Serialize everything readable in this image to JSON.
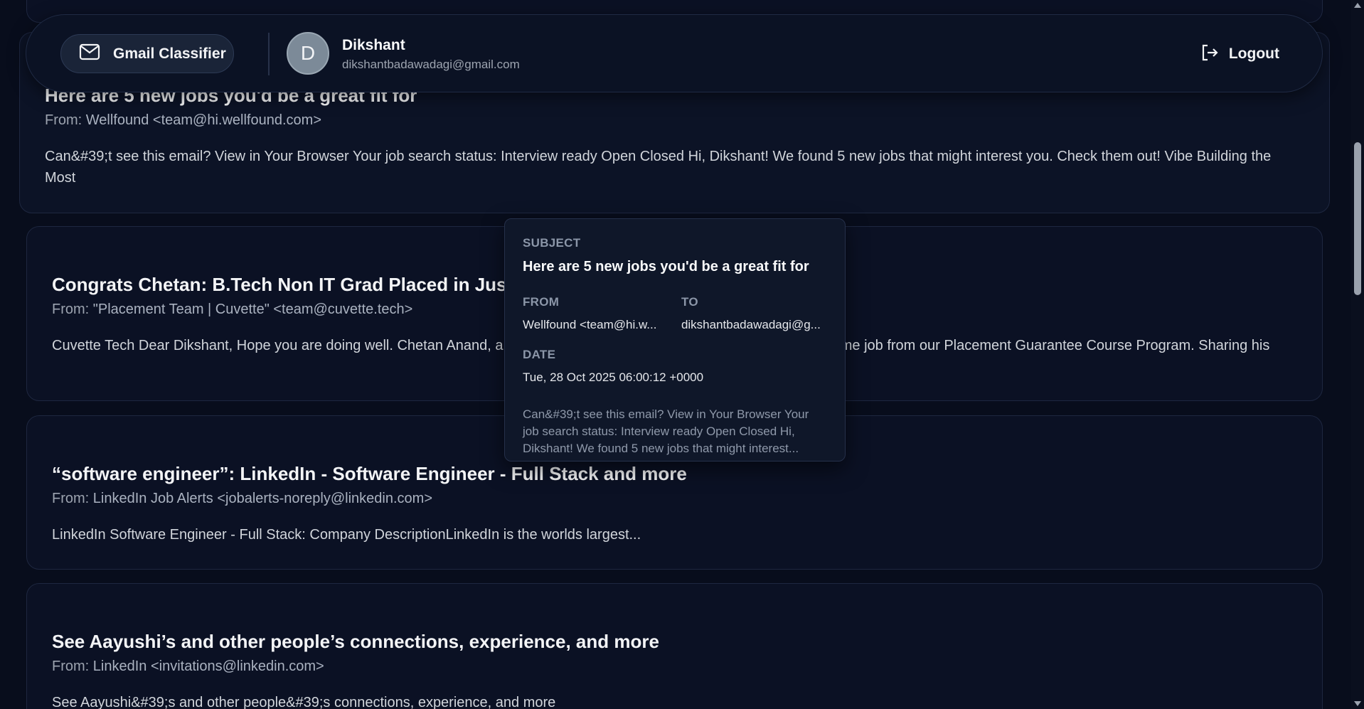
{
  "header": {
    "brand_label": "Gmail Classifier",
    "user": {
      "avatar_letter": "D",
      "name": "Dikshant",
      "email": "dikshantbadawadagi@gmail.com"
    },
    "logout_label": "Logout"
  },
  "from_prefix": "From:",
  "emails": [
    {
      "subject": "Here are 5 new jobs you'd be a great fit for",
      "sender": "Wellfound <team@hi.wellfound.com>",
      "snippet": "Can&#39;t see this email? View in Your Browser Your job search status: Interview ready Open Closed Hi, Dikshant! We found 5 new jobs that might interest you. Check them out! Vibe Building the Most"
    },
    {
      "subject": "Congrats Chetan: B.Tech Non IT Grad Placed in Just 2",
      "sender": "\"Placement Team | Cuvette\" <team@cuvette.tech>",
      "snippet": "Cuvette Tech Dear Dikshant, Hope you are doing well. Chetan Anand, a B.Tech Non IT Grad has successfully secured a full-time job from our Placement Guarantee Course Program. Sharing his"
    },
    {
      "subject": "“software engineer”: LinkedIn - Software Engineer - Full Stack and more",
      "sender": "LinkedIn Job Alerts <jobalerts-noreply@linkedin.com>",
      "snippet": "LinkedIn Software Engineer - Full Stack: Company DescriptionLinkedIn is the worlds largest..."
    },
    {
      "subject": "See Aayushi’s and other people’s connections, experience, and more",
      "sender": "LinkedIn <invitations@linkedin.com>",
      "snippet": "See Aayushi&#39;s and other people&#39;s connections, experience, and more"
    }
  ],
  "popup": {
    "subject_label": "SUBJECT",
    "subject": "Here are 5 new jobs you'd be a great fit for",
    "from_label": "FROM",
    "from": "Wellfound <team@hi.w...",
    "to_label": "TO",
    "to": "dikshantbadawadagi@g...",
    "date_label": "DATE",
    "date": "Tue, 28 Oct 2025 06:00:12 +0000",
    "preview": "Can&#39;t see this email? View in Your Browser Your job search status: Interview ready Open Closed Hi, Dikshant! We found 5 new jobs that might interest..."
  },
  "colors": {
    "background": "#080d1c",
    "card": "#0b1124",
    "accent_avatar": "#7c8a98"
  },
  "icons": {
    "brand": "mail-icon",
    "logout": "logout-icon"
  }
}
